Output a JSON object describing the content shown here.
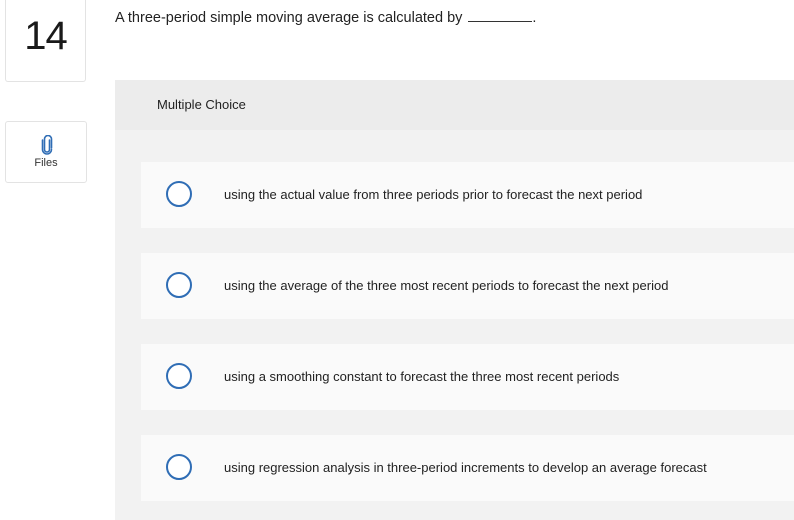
{
  "question": {
    "number": "14",
    "text": "A three-period simple moving average is calculated by",
    "blank_suffix": "."
  },
  "sidebar": {
    "files_label": "Files",
    "files_icon": "paperclip-icon"
  },
  "answer_panel": {
    "type_label": "Multiple Choice",
    "options": [
      {
        "label": "using the actual value from three periods prior to forecast the next period",
        "selected": false
      },
      {
        "label": "using the average of the three most recent periods to forecast the next period",
        "selected": false
      },
      {
        "label": "using a smoothing constant to forecast the three most recent periods",
        "selected": false
      },
      {
        "label": "using regression analysis in three-period increments to develop an average forecast",
        "selected": false
      }
    ]
  },
  "colors": {
    "accent": "#2f6db5",
    "panel_bg": "#f2f2f2",
    "option_bg": "#fafafa"
  }
}
